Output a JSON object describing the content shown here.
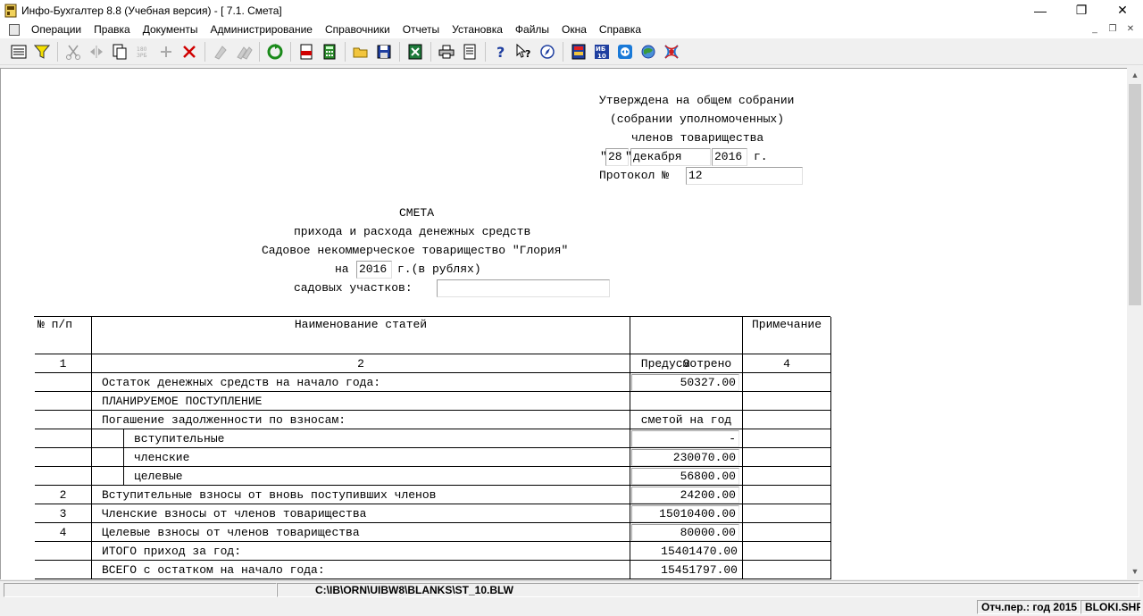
{
  "window": {
    "title": "Инфо-Бухгалтер 8.8 (Учебная версия) - [ 7.1. Смета]",
    "minimize": "—",
    "maximize": "❐",
    "close": "✕"
  },
  "menu": {
    "items": [
      "Операции",
      "Правка",
      "Документы",
      "Администрирование",
      "Справочники",
      "Отчеты",
      "Установка",
      "Файлы",
      "Окна",
      "Справка"
    ],
    "mdi_minimize": "_",
    "mdi_restore": "❐",
    "mdi_close": "✕"
  },
  "toolbar": {
    "icons": [
      "report-icon",
      "filter-icon",
      "cut-icon",
      "split-icon",
      "copy-doc-icon",
      "rotate-180-icon",
      "add-icon",
      "delete-icon",
      "mark-icon",
      "mark-all-icon",
      "refresh-icon",
      "pdf-export-icon",
      "calculator-icon",
      "open-folder-icon",
      "save-icon",
      "excel-icon",
      "print-icon",
      "print-preview-icon",
      "help-icon",
      "context-help-icon",
      "compass-icon",
      "book-icon",
      "ib10-icon",
      "teamviewer-icon",
      "web-icon",
      "network-icon"
    ],
    "ib10_label": "ИБ10"
  },
  "document": {
    "approved_line1": "Утверждена на общем собрании",
    "approved_line2": "(собрании уполномоченных)",
    "approved_line3": "членов товарищества",
    "quote_open": "\"",
    "day": "28",
    "quote_close": "\"",
    "month": "декабря",
    "year": "2016",
    "year_suffix": "г.",
    "protocol_label": "Протокол №",
    "protocol_no": "12",
    "heading": "СМЕТА",
    "subheading": "прихода и расхода денежных средств",
    "org_name": "Садовое некоммерческое товарищество \"Глория\"",
    "for_label": "на",
    "for_year": "2016",
    "for_suffix": "г.(в рублях)",
    "plots_label": "садовых участков:",
    "plots_value": ""
  },
  "table": {
    "headers": {
      "num": "№ п/п",
      "name": "Наименование статей",
      "planned_1": "Предусмотрено",
      "planned_2": "сметой на год",
      "note": "Примечание"
    },
    "col_numbers": [
      "1",
      "2",
      "3",
      "4"
    ],
    "rows": [
      {
        "num": "",
        "name": "Остаток денежных средств на начало года:",
        "value": "50327.00",
        "style": "field",
        "indent": 0
      },
      {
        "num": "",
        "name": "ПЛАНИРУЕМОЕ ПОСТУПЛЕНИЕ",
        "value": "",
        "style": "none",
        "indent": 0
      },
      {
        "num": "",
        "name": "Погашение задолженности по взносам:",
        "value": "",
        "style": "none",
        "indent": 0
      },
      {
        "num": "",
        "name": "вступительные",
        "value": "-",
        "style": "field",
        "indent": 1
      },
      {
        "num": "",
        "name": "членские",
        "value": "230070.00",
        "style": "field",
        "indent": 1
      },
      {
        "num": "",
        "name": "целевые",
        "value": "56800.00",
        "style": "field",
        "indent": 1
      },
      {
        "num": "2",
        "name": "Вступительные взносы от вновь поступивших членов",
        "value": "24200.00",
        "style": "field",
        "indent": 0
      },
      {
        "num": "3",
        "name": "Членские взносы от членов товарищества",
        "value": "15010400.00",
        "style": "field",
        "indent": 0
      },
      {
        "num": "4",
        "name": "Целевые взносы от членов товарищества",
        "value": "80000.00",
        "style": "field",
        "indent": 0
      },
      {
        "num": "",
        "name": "ИТОГО приход за год:",
        "value": "15401470.00",
        "style": "plain",
        "indent": 0
      },
      {
        "num": "",
        "name": "ВСЕГО с остатком на начало года:",
        "value": "15451797.00",
        "style": "plain",
        "indent": 0
      }
    ]
  },
  "status": {
    "path": "C:\\IB\\ORN\\UIBW8\\BLANKS\\ST_10.BLW",
    "period": "Отч.пер.: год 2015",
    "file": "BLOKI.SHP"
  }
}
